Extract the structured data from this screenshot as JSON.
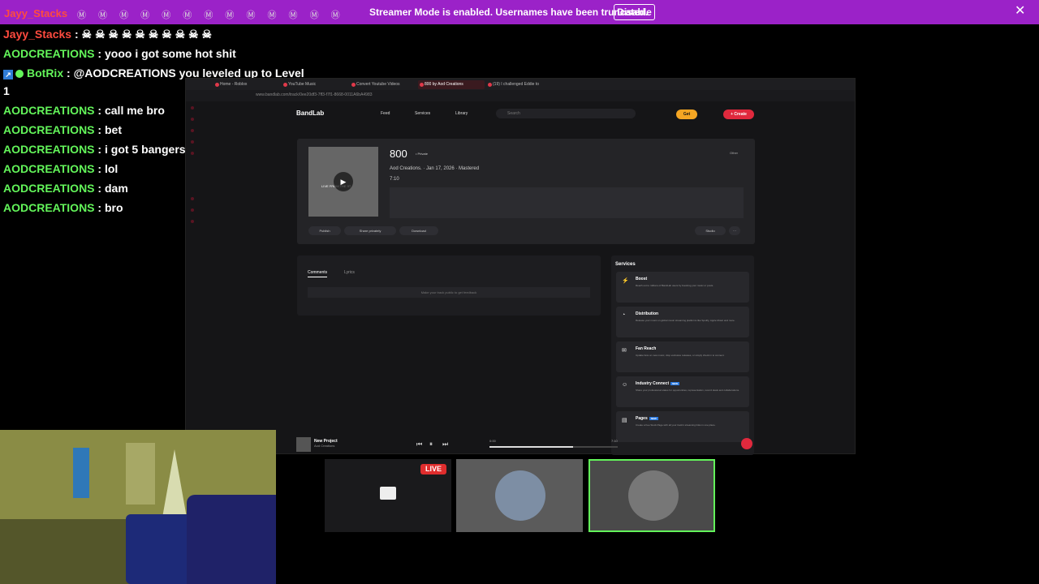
{
  "banner": {
    "user": "Jayy_Stacks",
    "emotes": "Ⓜ Ⓜ Ⓜ Ⓜ Ⓜ Ⓜ Ⓜ Ⓜ Ⓜ Ⓜ Ⓜ Ⓜ Ⓜ",
    "text": "Streamer Mode is enabled. Usernames have been truncated.",
    "disable_label": "Disable",
    "close_symbol": "✕",
    "color": "#9b22c8"
  },
  "chat": {
    "lines": [
      {
        "user": "Jayy_Stacks",
        "sep": " : ",
        "msg": "☠ ☠ ☠ ☠ ☠ ☠ ☠ ☠ ☠ ☠"
      },
      {
        "user": "AODCREATIONS",
        "sep": " : ",
        "msg": "yooo i got some hot shit"
      },
      {
        "user": "BotRix",
        "sep": " : ",
        "msg": "@AODCREATIONS you leveled up to Level"
      },
      {
        "user": "",
        "sep": "",
        "msg": "1"
      },
      {
        "user": "AODCREATIONS",
        "sep": " : ",
        "msg": "call me bro"
      },
      {
        "user": "AODCREATIONS",
        "sep": " : ",
        "msg": "bet"
      },
      {
        "user": "AODCREATIONS",
        "sep": " : ",
        "msg": "i got 5 bangers for u"
      },
      {
        "user": "AODCREATIONS",
        "sep": " : ",
        "msg": "lol"
      },
      {
        "user": "AODCREATIONS",
        "sep": " : ",
        "msg": "dam"
      },
      {
        "user": "AODCREATIONS",
        "sep": " : ",
        "msg": "bro"
      }
    ],
    "bot_icon": "↗"
  },
  "browser": {
    "tabs": [
      "Home - Roblox",
      "YouTube Music",
      "Convert Youtube Videos",
      "800 by Aod Creations",
      "(19) I challenged Eddie to"
    ],
    "url": "www.bandlab.com/track/0ee20df3-7ff3-f7f1-8668-0011A6bA4983",
    "nav": {
      "logo": "BandLab",
      "feed": "Feed",
      "services": "Services",
      "library": "Library",
      "search_placeholder": "Search",
      "get": "Get",
      "create": "+ Create"
    },
    "track": {
      "title": "800",
      "privacy": "• Private",
      "meta": "Aod Creations. · Jan 17, 2026 · Mastered",
      "duration": "7:10",
      "other": "Other",
      "cover_text": "LIVE FROM THE 9T",
      "play_symbol": "▶",
      "actions": [
        "Publish",
        "Share privately",
        "Download"
      ],
      "studio": "Studio",
      "more": "···"
    },
    "comments": {
      "tabs": [
        "Comments",
        "Lyrics"
      ],
      "box": "Make your track public to get feedback"
    },
    "services": {
      "heading": "Services",
      "items": [
        {
          "icon": "⚡",
          "name": "Boost",
          "new": "",
          "desc": "Reach out to millions of BandLab users by boosting your music or posts."
        },
        {
          "icon": "◔",
          "name": "Distribution",
          "new": "",
          "desc": "Release your music on global music streaming platforms like Spotify, Apple Music and more."
        },
        {
          "icon": "✉",
          "name": "Fan Reach",
          "new": "",
          "desc": "Update fans on new music, drop exclusive releases, or simply check in to connect."
        },
        {
          "icon": "☺",
          "name": "Industry Connect",
          "new": "NEW",
          "desc": "Share your professional status for opportunities, representation, record deals and collaborations."
        },
        {
          "icon": "▤",
          "name": "Pages",
          "new": "NEW",
          "desc": "Create a free Stock Page with all your track's streaming links in one place."
        }
      ]
    },
    "player": {
      "title": "New Project",
      "artist": "Aod Creations",
      "time_start": "0:00",
      "time_end": "7:10",
      "progress": 0.65,
      "prev": "⏮",
      "pause": "⏸",
      "next": "⏭"
    }
  },
  "overlay": {
    "live_label": "LIVE"
  }
}
